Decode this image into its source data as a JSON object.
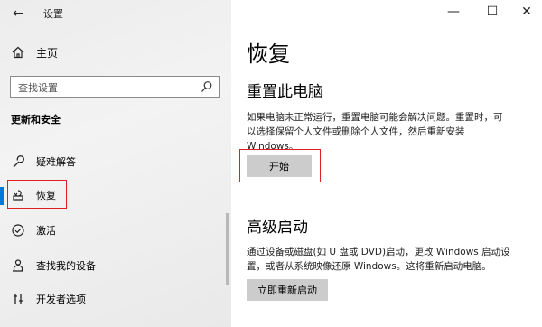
{
  "window": {
    "title": "设置",
    "controls": {
      "minimize": "—",
      "maximize": "☐",
      "close": "✕"
    }
  },
  "sidebar": {
    "back_glyph": "←",
    "home_label": "主页",
    "search_placeholder": "查找设置",
    "section_title": "更新和安全",
    "items": [
      {
        "label": "疑难解答",
        "icon": "wrench-icon"
      },
      {
        "label": "恢复",
        "icon": "recovery-icon",
        "selected": true
      },
      {
        "label": "激活",
        "icon": "check-circle-icon"
      },
      {
        "label": "查找我的设备",
        "icon": "person-location-icon"
      },
      {
        "label": "开发者选项",
        "icon": "developer-icon"
      }
    ]
  },
  "main": {
    "page_title": "恢复",
    "reset": {
      "heading": "重置此电脑",
      "line1": "如果电脑未正常运行，重置电脑可能会解决问题。重置时，可",
      "line2": "以选择保留个人文件或删除个人文件，然后重新安装",
      "line3": "Windows。",
      "button": "开始"
    },
    "advanced": {
      "heading": "高级启动",
      "line1": "通过设备或磁盘(如 U 盘或 DVD)启动，更改 Windows 启动设",
      "line2": "置，或者从系统映像还原 Windows。这将重新启动电脑。",
      "button": "立即重新启动"
    }
  },
  "colors": {
    "accent": "#0078d7",
    "highlight_box": "#e02020",
    "button_bg": "#cccccc"
  }
}
